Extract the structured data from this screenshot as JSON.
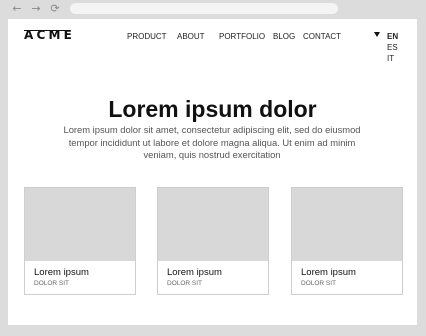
{
  "browser": {
    "back_icon": "←",
    "forward_icon": "→",
    "reload_icon": "⟳",
    "address": ""
  },
  "brand": {
    "logo": "ACME"
  },
  "nav": {
    "items": [
      {
        "label": "PRODUCT"
      },
      {
        "label": "ABOUT"
      },
      {
        "label": "PORTFOLIO"
      },
      {
        "label": "BLOG"
      },
      {
        "label": "CONTACT"
      }
    ]
  },
  "language": {
    "options": [
      {
        "label": "EN",
        "selected": true
      },
      {
        "label": "ES"
      },
      {
        "label": "IT"
      }
    ]
  },
  "hero": {
    "title": "Lorem ipsum dolor",
    "text": "Lorem ipsum dolor sit amet, consectetur adipiscing elit, sed do eiusmod tempor incididunt ut labore et dolore magna aliqua. Ut enim ad minim veniam, quis nostrud exercitation"
  },
  "cards": [
    {
      "title": "Lorem ipsum",
      "subtitle": "DOLOR SIT"
    },
    {
      "title": "Lorem ipsum",
      "subtitle": "DOLOR SIT"
    },
    {
      "title": "Lorem ipsum",
      "subtitle": "DOLOR SIT"
    }
  ],
  "colors": {
    "chrome": "#dcdcdc",
    "page": "#ffffff",
    "placeholder": "#d8d8d8",
    "text": "#222222",
    "muted": "#555555"
  }
}
